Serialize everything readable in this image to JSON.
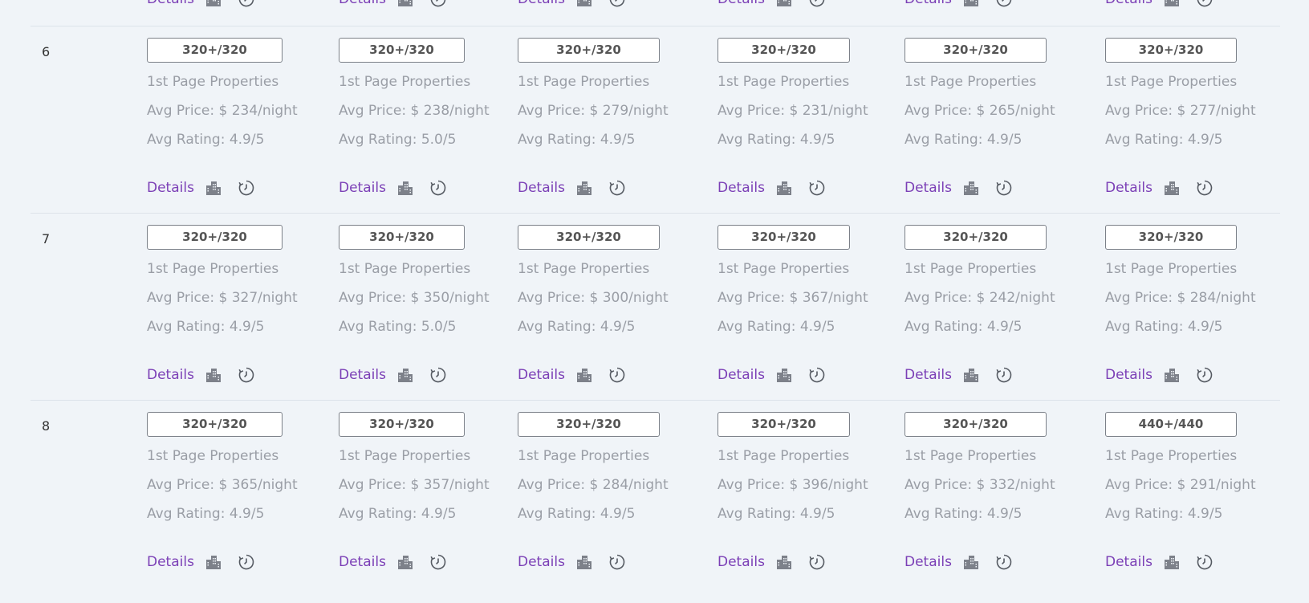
{
  "labels": {
    "details": "Details",
    "first_page_properties": "1st Page Properties"
  },
  "icons": {
    "buildings": "buildings-icon",
    "history": "history-icon"
  },
  "colors": {
    "background": "#f0f4f8",
    "details_link": "#7b3fb6",
    "meta_text": "#9a9ea6",
    "icon": "#7d818a"
  },
  "columns": 6,
  "rows": [
    {
      "number": "6",
      "cells": [
        {
          "count": "320+/320",
          "price": "Avg Price: $ 234/night",
          "rating": "Avg Rating: 4.9/5"
        },
        {
          "count": "320+/320",
          "price": "Avg Price: $ 238/night",
          "rating": "Avg Rating: 5.0/5"
        },
        {
          "count": "320+/320",
          "price": "Avg Price: $ 279/night",
          "rating": "Avg Rating: 4.9/5"
        },
        {
          "count": "320+/320",
          "price": "Avg Price: $ 231/night",
          "rating": "Avg Rating: 4.9/5"
        },
        {
          "count": "320+/320",
          "price": "Avg Price: $ 265/night",
          "rating": "Avg Rating: 4.9/5"
        },
        {
          "count": "320+/320",
          "price": "Avg Price: $ 277/night",
          "rating": "Avg Rating: 4.9/5"
        }
      ]
    },
    {
      "number": "7",
      "cells": [
        {
          "count": "320+/320",
          "price": "Avg Price: $ 327/night",
          "rating": "Avg Rating: 4.9/5"
        },
        {
          "count": "320+/320",
          "price": "Avg Price: $ 350/night",
          "rating": "Avg Rating: 5.0/5"
        },
        {
          "count": "320+/320",
          "price": "Avg Price: $ 300/night",
          "rating": "Avg Rating: 4.9/5"
        },
        {
          "count": "320+/320",
          "price": "Avg Price: $ 367/night",
          "rating": "Avg Rating: 4.9/5"
        },
        {
          "count": "320+/320",
          "price": "Avg Price: $ 242/night",
          "rating": "Avg Rating: 4.9/5"
        },
        {
          "count": "320+/320",
          "price": "Avg Price: $ 284/night",
          "rating": "Avg Rating: 4.9/5"
        }
      ]
    },
    {
      "number": "8",
      "cells": [
        {
          "count": "320+/320",
          "price": "Avg Price: $ 365/night",
          "rating": "Avg Rating: 4.9/5"
        },
        {
          "count": "320+/320",
          "price": "Avg Price: $ 357/night",
          "rating": "Avg Rating: 4.9/5"
        },
        {
          "count": "320+/320",
          "price": "Avg Price: $ 284/night",
          "rating": "Avg Rating: 4.9/5"
        },
        {
          "count": "320+/320",
          "price": "Avg Price: $ 396/night",
          "rating": "Avg Rating: 4.9/5"
        },
        {
          "count": "320+/320",
          "price": "Avg Price: $ 332/night",
          "rating": "Avg Rating: 4.9/5"
        },
        {
          "count": "440+/440",
          "price": "Avg Price: $ 291/night",
          "rating": "Avg Rating: 4.9/5"
        }
      ]
    }
  ]
}
